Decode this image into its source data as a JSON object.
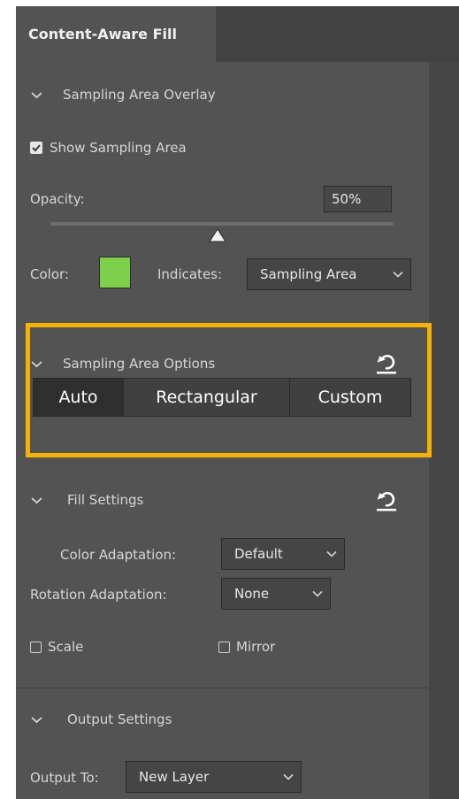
{
  "panel_tab": {
    "label": "Content-Aware Fill"
  },
  "sampling_overlay": {
    "title": "Sampling Area Overlay",
    "show_label": "Show Sampling Area",
    "show_checked": true,
    "opacity_label": "Opacity:",
    "opacity_value": "50%",
    "opacity_fraction": 0.5,
    "color_label": "Color:",
    "color_swatch": "#7ed04a",
    "indicates_label": "Indicates:",
    "indicates_value": "Sampling Area"
  },
  "sampling_options": {
    "title": "Sampling Area Options",
    "modes": [
      "Auto",
      "Rectangular",
      "Custom"
    ],
    "selected_mode": "Auto",
    "highlight_color": "#f5b301"
  },
  "fill_settings": {
    "title": "Fill Settings",
    "color_adaptation_label": "Color Adaptation:",
    "color_adaptation_value": "Default",
    "rotation_adaptation_label": "Rotation Adaptation:",
    "rotation_adaptation_value": "None",
    "scale_label": "Scale",
    "scale_checked": false,
    "mirror_label": "Mirror",
    "mirror_checked": false
  },
  "output_settings": {
    "title": "Output Settings",
    "output_to_label": "Output To:",
    "output_to_value": "New Layer"
  }
}
